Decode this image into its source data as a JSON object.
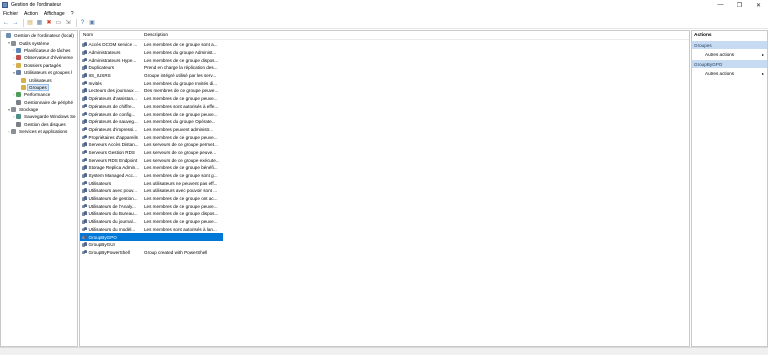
{
  "window": {
    "title": "Gestion de l'ordinateur",
    "controls": [
      "—",
      "❐",
      "✕"
    ]
  },
  "menu": [
    "Fichier",
    "Action",
    "Affichage",
    "?"
  ],
  "toolbar": {
    "buttons": [
      {
        "icon": "back-arrow-icon",
        "glyph": "←",
        "color": "#2b6fbf"
      },
      {
        "icon": "forward-arrow-icon",
        "glyph": "→",
        "color": "#2b6fbf"
      },
      {
        "icon": "folder-icon",
        "glyph": "▤",
        "color": "#c9a24a"
      },
      {
        "icon": "console-tree-icon",
        "glyph": "▦",
        "color": "#5a7fa8"
      },
      {
        "icon": "delete-icon",
        "glyph": "✖",
        "color": "#d23a2a"
      },
      {
        "icon": "properties-icon",
        "glyph": "▭",
        "color": "#6b6b6b"
      },
      {
        "icon": "export-icon",
        "glyph": "⇲",
        "color": "#6b6b6b"
      },
      {
        "icon": "help-icon",
        "glyph": "?",
        "color": "#2b6fbf"
      },
      {
        "icon": "new-window-icon",
        "glyph": "▣",
        "color": "#5a7fa8"
      }
    ]
  },
  "tree": [
    {
      "label": "Gestion de l'ordinateur (local)",
      "indent": 0,
      "twisty": "",
      "icon": "#6d8fb5"
    },
    {
      "label": "Outils système",
      "indent": 1,
      "twisty": "▾",
      "icon": "#8a8f96"
    },
    {
      "label": "Planificateur de tâches",
      "indent": 2,
      "twisty": "›",
      "icon": "#5a86b8"
    },
    {
      "label": "Observateur d'événeme",
      "indent": 2,
      "twisty": "›",
      "icon": "#c0504d"
    },
    {
      "label": "Dossiers partagés",
      "indent": 2,
      "twisty": "›",
      "icon": "#d6b04c"
    },
    {
      "label": "Utilisateurs et groupes l",
      "indent": 2,
      "twisty": "▾",
      "icon": "#6a7fa3"
    },
    {
      "label": "Utilisateurs",
      "indent": 3,
      "twisty": "",
      "icon": "#d6b04c"
    },
    {
      "label": "Groupes",
      "indent": 3,
      "twisty": "",
      "icon": "#d6b04c",
      "selected": true
    },
    {
      "label": "Performance",
      "indent": 2,
      "twisty": "›",
      "icon": "#4f9d5a"
    },
    {
      "label": "Gestionnaire de périphé",
      "indent": 2,
      "twisty": "",
      "icon": "#7a7f88"
    },
    {
      "label": "Stockage",
      "indent": 1,
      "twisty": "▾",
      "icon": "#8a8f96"
    },
    {
      "label": "Sauvegarde Windows Se",
      "indent": 2,
      "twisty": "›",
      "icon": "#4f8f8a"
    },
    {
      "label": "Gestion des disques",
      "indent": 2,
      "twisty": "",
      "icon": "#7a7f88"
    },
    {
      "label": "Services et applications",
      "indent": 1,
      "twisty": "›",
      "icon": "#8a8f96"
    }
  ],
  "list": {
    "columns": {
      "name": "Nom",
      "description": "Description"
    },
    "rows": [
      {
        "name": "Accès DCOM service ...",
        "description": "Les membres de ce groupe sont a..."
      },
      {
        "name": "Administrateurs",
        "description": "Les membres du groupe Administ..."
      },
      {
        "name": "Administrateurs Hype...",
        "description": "Les membres de ce groupe dispos..."
      },
      {
        "name": "Duplicateurs",
        "description": "Prend en charge la réplication des..."
      },
      {
        "name": "IIS_IUSRS",
        "description": "Groupe intégré utilisé par les serv..."
      },
      {
        "name": "Invités",
        "description": "Les membres du groupe Invités di..."
      },
      {
        "name": "Lecteurs des journaux ...",
        "description": "Des membres de ce groupe peuve..."
      },
      {
        "name": "Opérateurs d'assistan...",
        "description": "Les membres de ce groupe peuve..."
      },
      {
        "name": "Opérateurs de chiffre...",
        "description": "Les membres sont autorisés à effe..."
      },
      {
        "name": "Opérateurs de config...",
        "description": "Les membres de ce groupe peuve..."
      },
      {
        "name": "Opérateurs de sauveg...",
        "description": "Les membres du groupe Opérate..."
      },
      {
        "name": "Opérateurs d'impressi...",
        "description": "Les membres peuvent administr..."
      },
      {
        "name": "Propriétaires d'appareils",
        "description": "Les membres de ce groupe peuve..."
      },
      {
        "name": "Serveurs Accès Distan...",
        "description": "Les serveurs de ce groupe permet..."
      },
      {
        "name": "Serveurs Gestion RDS",
        "description": "Les serveurs de ce groupe peuve..."
      },
      {
        "name": "Serveurs RDS Endpoint",
        "description": "Les serveurs de ce groupe exécute..."
      },
      {
        "name": "Storage Replica Admin...",
        "description": "Les membres de ce groupe bénéfi..."
      },
      {
        "name": "System Managed Acc...",
        "description": "Les membres de ce groupe sont g..."
      },
      {
        "name": "Utilisateurs",
        "description": "Les utilisateurs ne peuvent pas eff..."
      },
      {
        "name": "Utilisateurs avec pouv...",
        "description": "Les utilisateurs avec pouvoir sont ..."
      },
      {
        "name": "Utilisateurs de gestion...",
        "description": "Les membres de ce groupe ont ac..."
      },
      {
        "name": "Utilisateurs de l'Analy...",
        "description": "Les membres de ce groupe peuve..."
      },
      {
        "name": "Utilisateurs du Bureau...",
        "description": "Les membres de ce groupe dispos..."
      },
      {
        "name": "Utilisateurs du journal...",
        "description": "Les membres de ce groupe peuve..."
      },
      {
        "name": "Utilisateurs du modèl...",
        "description": "Les membres sont autorisés à lan..."
      },
      {
        "name": "GroupByGPO",
        "description": "",
        "selected": true
      },
      {
        "name": "GroupByGUI",
        "description": ""
      },
      {
        "name": "GroupByPowerShell",
        "description": "Group created with PowerShell"
      }
    ]
  },
  "actions": {
    "header": "Actions",
    "sections": [
      {
        "title": "Groupes",
        "items": [
          "Autres actions"
        ]
      },
      {
        "title": "GroupByGPO",
        "items": [
          "Autres actions"
        ]
      }
    ]
  },
  "colors": {
    "selection": "#0078d7",
    "section_bg": "#c6dbf1"
  }
}
